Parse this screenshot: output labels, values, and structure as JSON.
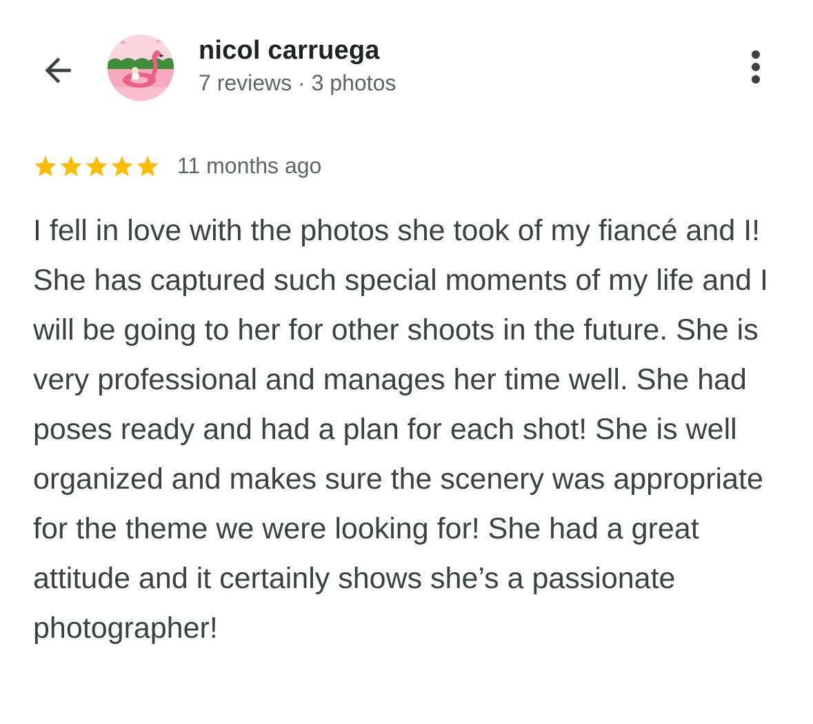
{
  "header": {
    "back_icon": "arrow-back-icon",
    "avatar_icon": "flamingo-avatar-image",
    "reviewer_name": "nicol carruega",
    "reviewer_meta": "7 reviews · 3 photos",
    "more_icon": "more-vertical-icon"
  },
  "review": {
    "rating": 5,
    "max_rating": 5,
    "star_icon": "star-icon",
    "star_color": "#fbbc04",
    "time": "11 months ago",
    "text": "I fell in love with the photos she took of my fiancé and I! She has captured such special moments of my life and I will be going to her for other shoots in the future. She is very professional and manages her time well. She had poses ready and had a plan for each shot! She is well organized and makes sure the scenery was appropriate for the theme we were looking for! She had a great attitude and it certainly shows she’s a passionate photographer!"
  },
  "colors": {
    "text_primary": "#202124",
    "text_secondary": "#5f6368",
    "text_body": "#3c4043",
    "star": "#fbbc04"
  }
}
